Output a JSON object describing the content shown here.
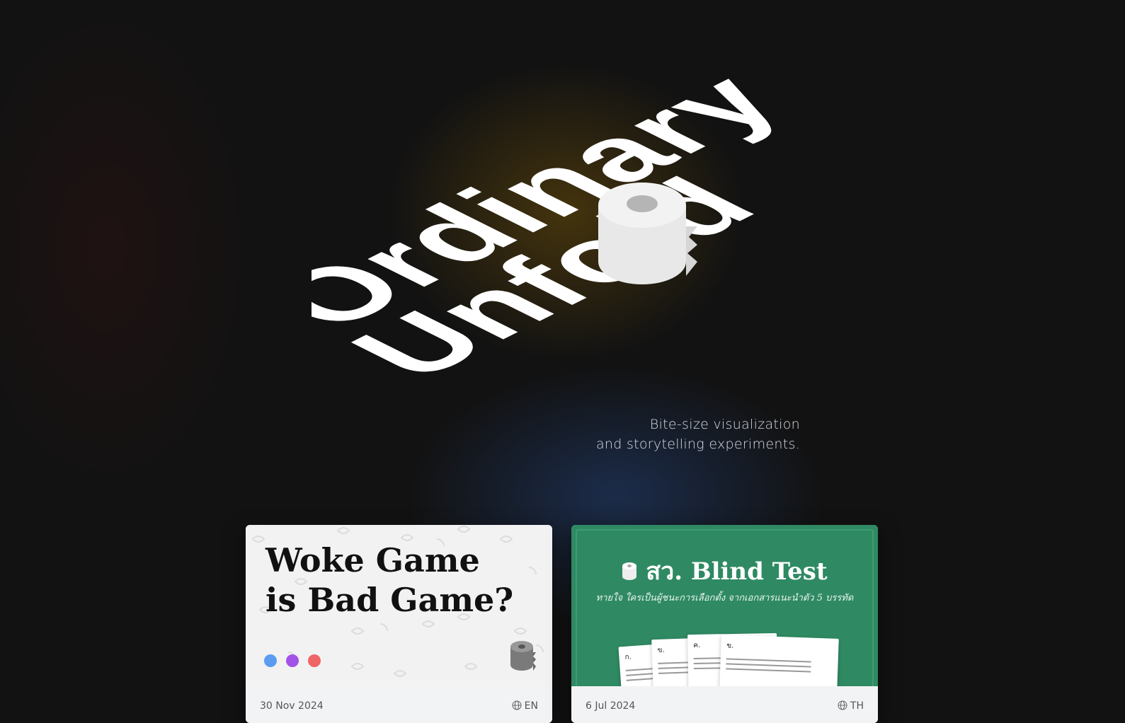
{
  "hero": {
    "logo_line1": "Ordinary",
    "logo_line2": "Unfold",
    "logo_icon": "toilet-paper-roll-icon",
    "tagline_line1": "Bite-size visualization",
    "tagline_line2": "and storytelling experiments."
  },
  "colors": {
    "background": "#121212",
    "card1_dot1": "#5b9cf0",
    "card1_dot2": "#a352e8",
    "card1_dot3": "#ef6464",
    "card2_thumb": "#2f8a63"
  },
  "cards": [
    {
      "title_line1": "Woke Game",
      "title_line2": "is Bad Game?",
      "date": "30 Nov 2024",
      "language": "EN",
      "language_icon": "globe-icon"
    },
    {
      "title": "สว. Blind Test",
      "subtitle": "ทายใจ ใครเป็นผู้ชนะการเลือกตั้ง จากเอกสารแนะนำตัว 5 บรรทัด",
      "papers": [
        "ก.",
        "ข.",
        "ค.",
        "ข."
      ],
      "date": "6 Jul 2024",
      "language": "TH",
      "language_icon": "globe-icon"
    }
  ]
}
